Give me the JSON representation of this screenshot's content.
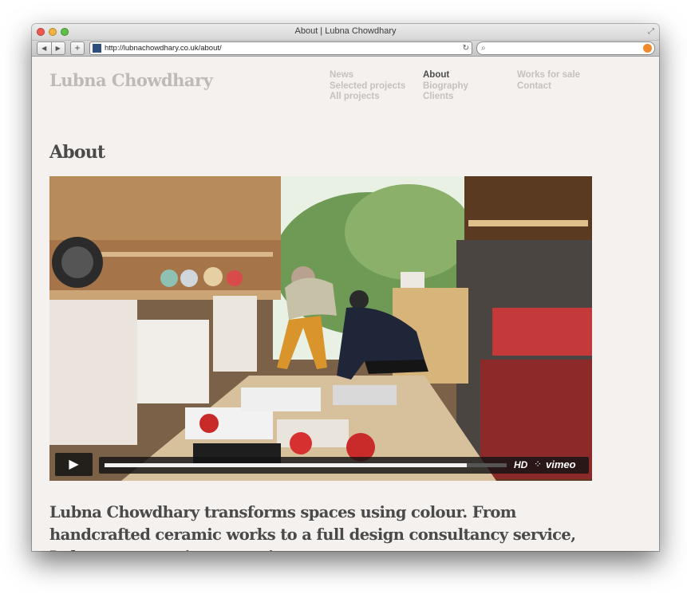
{
  "browser": {
    "window_title": "About | Lubna Chowdhary",
    "url": "http://lubnachowdhary.co.uk/about/",
    "back_label": "◀",
    "forward_label": "▶",
    "add_tab_label": "+",
    "search_placeholder": ""
  },
  "site": {
    "logo": "Lubna Chowdhary",
    "nav": {
      "col1": [
        "News",
        "Selected projects",
        "All projects"
      ],
      "col2": [
        "About",
        "Biography",
        "Clients"
      ],
      "col3": [
        "Works for sale",
        "Contact"
      ],
      "current": "About"
    },
    "page_title": "About",
    "intro": "Lubna Chowdhary transforms spaces using colour. From handcrafted ceramic works to a full design consultancy service, Lubna uses a unique creative..."
  },
  "video": {
    "play_label": "▶",
    "progress": 0.9,
    "hd_label": "HD",
    "brand": "vimeo"
  },
  "colors": {
    "page_bg": "#f4f1ef",
    "nav_inactive": "#c4c1be",
    "nav_active": "#4c4c4c",
    "heading": "#4a4a4a"
  }
}
